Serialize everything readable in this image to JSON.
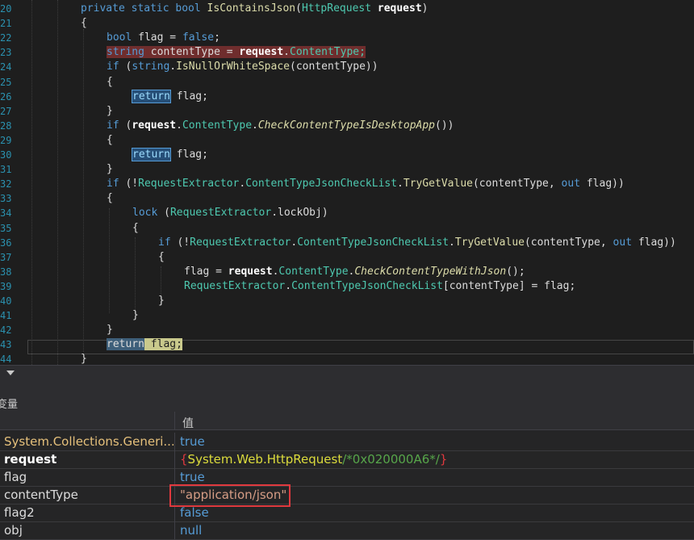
{
  "editor": {
    "line_numbers": [
      "20",
      "21",
      "22",
      "23",
      "24",
      "25",
      "26",
      "27",
      "28",
      "29",
      "30",
      "31",
      "32",
      "33",
      "34",
      "35",
      "36",
      "37",
      "38",
      "39",
      "40",
      "41",
      "42",
      "43",
      "44"
    ],
    "lines": {
      "l20": {
        "kw1": "private static ",
        "kw2": "bool ",
        "name": "IsContainsJson",
        "p1": "(",
        "ty": "HttpRequest",
        "p2": " ",
        "arg": "request",
        "p3": ")"
      },
      "l21": "{",
      "l22": {
        "kw": "bool ",
        "rest": "flag = ",
        "kw2": "false",
        ";": ";"
      },
      "l23": {
        "kw": "string ",
        "a": "contentType = ",
        "b": "request",
        ".": ".",
        "c": "ContentType;"
      },
      "l24": {
        "kw": "if ",
        "a": "(",
        "b": "string",
        ".": ".",
        "c": "IsNullOrWhiteSpace",
        "d": "(contentType))"
      },
      "l25": "{",
      "l26": {
        "kw": "return",
        "rest": " flag;"
      },
      "l27": "}",
      "l28": {
        "kw": "if ",
        "a": "(",
        "b": "request",
        ".": ".",
        "c": "ContentType",
        ".2": ".",
        "d": "CheckContentTypeIsDesktopApp",
        "e": "())"
      },
      "l29": "{",
      "l30": {
        "kw": "return",
        "rest": " flag;"
      },
      "l31": "}",
      "l32": {
        "kw": "if ",
        "a": "(!",
        "b": "RequestExtractor",
        ".": ".",
        "c": "ContentTypeJsonCheckList",
        ".2": ".",
        "d": "TryGetValue",
        "e": "(contentType, ",
        "f": "out",
        "g": " flag))"
      },
      "l33": "{",
      "l34": {
        "kw": "lock ",
        "a": "(",
        "b": "RequestExtractor",
        ".": ".",
        "c": "lockObj)"
      },
      "l35": "{",
      "l36": {
        "kw": "if ",
        "a": "(!",
        "b": "RequestExtractor",
        ".": ".",
        "c": "ContentTypeJsonCheckList",
        ".2": ".",
        "d": "TryGetValue",
        "e": "(contentType, ",
        "f": "out",
        "g": " flag))"
      },
      "l37": "{",
      "l38": {
        "a": "flag = ",
        "b": "request",
        ".": ".",
        "c": "ContentType",
        ".2": ".",
        "d": "CheckContentTypeWithJson",
        "e": "();"
      },
      "l39": {
        "b": "RequestExtractor",
        ".": ".",
        "c": "ContentTypeJsonCheckList",
        "d": "[contentType] = flag;"
      },
      "l40": "}",
      "l41": "}",
      "l42": "}",
      "l43": {
        "kw": "return",
        "rest": " flag;"
      },
      "l44": "}"
    }
  },
  "panel": {
    "title": "变量",
    "col_value": "值",
    "rows": [
      {
        "name": "System.Collections.Generi...",
        "value": "true"
      },
      {
        "name": "request",
        "value_open": "{",
        "value_type": "System.Web.HttpRequest",
        "value_comment": "/*0x020000A6*/",
        "value_close": "}"
      },
      {
        "name": "flag",
        "value": "true"
      },
      {
        "name": "contentType",
        "value": "\"application/json\""
      },
      {
        "name": "flag2",
        "value": "false"
      },
      {
        "name": "obj",
        "value": "null"
      }
    ]
  },
  "colors": {
    "keyword": "#569cd6",
    "type": "#4ec9b0",
    "method": "#dcdcaa",
    "error": "#6f2d2d",
    "highlight_box": "#e0393e"
  }
}
